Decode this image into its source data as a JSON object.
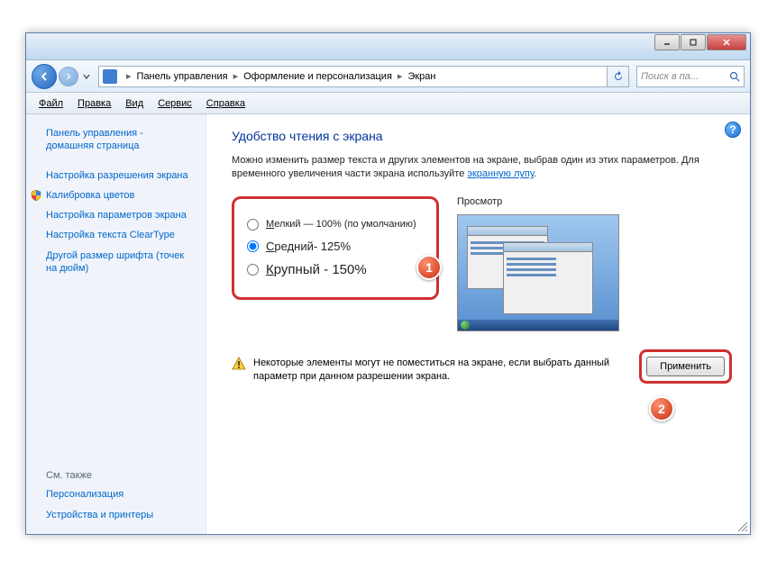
{
  "breadcrumb": {
    "part1": "Панель управления",
    "part2": "Оформление и персонализация",
    "part3": "Экран"
  },
  "search": {
    "placeholder": "Поиск в па..."
  },
  "menu": {
    "file": "Файл",
    "edit": "Правка",
    "view": "Вид",
    "tools": "Сервис",
    "help": "Справка"
  },
  "sidebar": {
    "home": "Панель управления - домашняя страница",
    "resolution": "Настройка разрешения экрана",
    "calibration": "Калибровка цветов",
    "params": "Настройка параметров экрана",
    "cleartype": "Настройка текста ClearType",
    "dpi": "Другой размер шрифта (точек на дюйм)",
    "seealso": "См. также",
    "personalization": "Персонализация",
    "devices": "Устройства и принтеры"
  },
  "content": {
    "title": "Удобство чтения с экрана",
    "desc1": "Можно изменить размер текста и других элементов на экране, выбрав один из этих параметров. Для временного увеличения части экрана используйте ",
    "magnifier_link": "экранную лупу",
    "radio_small_prefix": "М",
    "radio_small_rest": "елкий — 100% (по умолчанию)",
    "radio_medium_prefix": "С",
    "radio_medium_rest": "редний- 125%",
    "radio_large_prefix": "К",
    "radio_large_rest": "рупный - 150%",
    "preview_label": "Просмотр",
    "warning": "Некоторые элементы могут не поместиться на экране, если выбрать данный параметр при данном разрешении экрана.",
    "apply": "Применить"
  },
  "callouts": {
    "one": "1",
    "two": "2"
  }
}
